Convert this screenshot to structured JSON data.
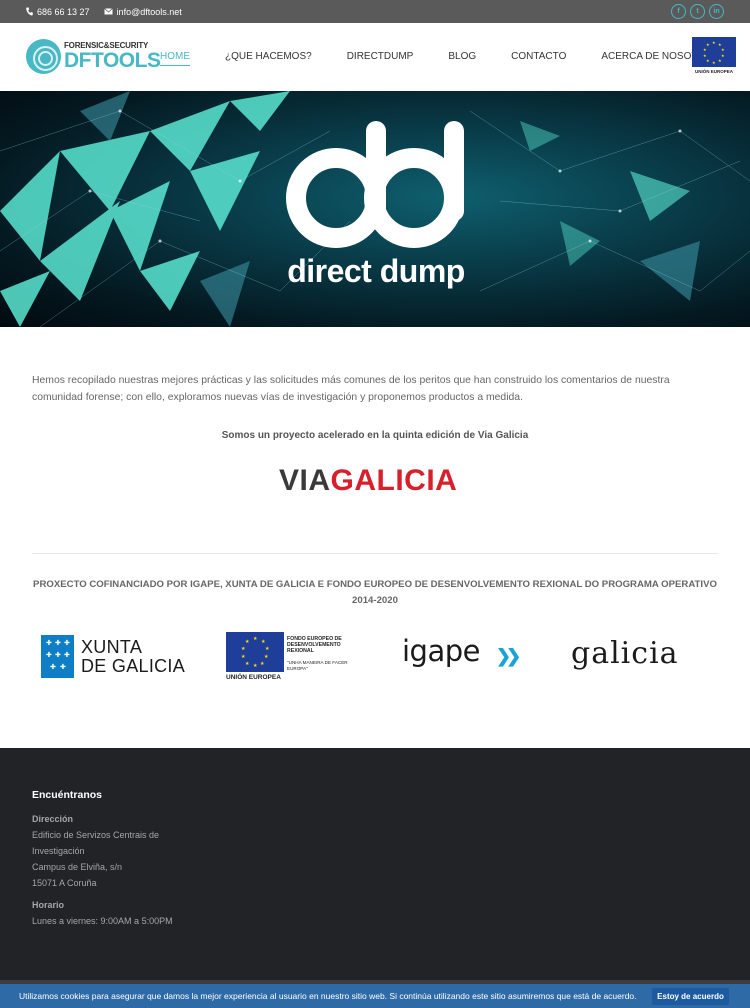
{
  "topbar": {
    "phone": "686 66 13 27",
    "email": "info@dftools.net",
    "phone_icon": "phone-icon",
    "email_icon": "envelope-icon",
    "socials": [
      "f",
      "t",
      "in"
    ]
  },
  "header": {
    "logo_sub": "FORENSIC&SECURITY",
    "logo_main": "DFTOOLS",
    "nav": [
      "HOME",
      "¿QUE HACEMOS?",
      "DIRECTDUMP",
      "BLOG",
      "CONTACTO",
      "ACERCA DE NOSOTROS"
    ],
    "active_nav": "HOME",
    "eu_caption": "UNIÓN EUROPEA"
  },
  "hero": {
    "title": "direct dump"
  },
  "main": {
    "intro": "Hemos recopilado nuestras mejores prácticas y las solicitudes más comunes de los peritos que han construido los comentarios de nuestra comunidad forense; con ello,  exploramos nuevas vías de investigación y proponemos productos a medida.",
    "accelerated": "Somos un proyecto acelerado en la quinta edición de Via Galicia",
    "viagalicia_via": "VIA",
    "viagalicia_galicia": "GALICIA",
    "cofinanced": "PROXECTO COFINANCIADO POR IGAPE, XUNTA DE GALICIA E FONDO EUROPEO DE DESENVOLVEMENTO REXIONAL DO PROGRAMA OPERATIVO 2014-2020"
  },
  "sponsors": {
    "xunta_line1": "XUNTA",
    "xunta_line2": "DE GALICIA",
    "feder_caption": "UNIÓN EUROPEA",
    "feder_title": "FONDO EUROPEO DE DESENVOLVEMENTO REXIONAL",
    "feder_motto": "\"UNHA MANEIRA DE FACER EUROPA\"",
    "igape": "igape",
    "galicia": "galicia"
  },
  "footer": {
    "title": "Encuéntranos",
    "address_label": "Dirección",
    "address_lines": [
      "Edificio de Servizos Centrais de",
      "Investigación",
      "Campus de Elviña, s/n",
      "15071 A Coruña"
    ],
    "hours_label": "Horario",
    "hours": "Lunes a viernes: 9:00AM a 5:00PM"
  },
  "cookie": {
    "text": "Utilizamos cookies para asegurar que damos la mejor experiencia al usuario en nuestro sitio web. Si continúa utilizando este sitio asumiremos que está de acuerdo.",
    "button": "Estoy de acuerdo"
  },
  "colors": {
    "accent": "#47b8c4",
    "topbar": "#5a5a5a",
    "footer": "#212326",
    "cookie_bar": "#2e6aa6",
    "viagalicia_red": "#d8202c"
  }
}
